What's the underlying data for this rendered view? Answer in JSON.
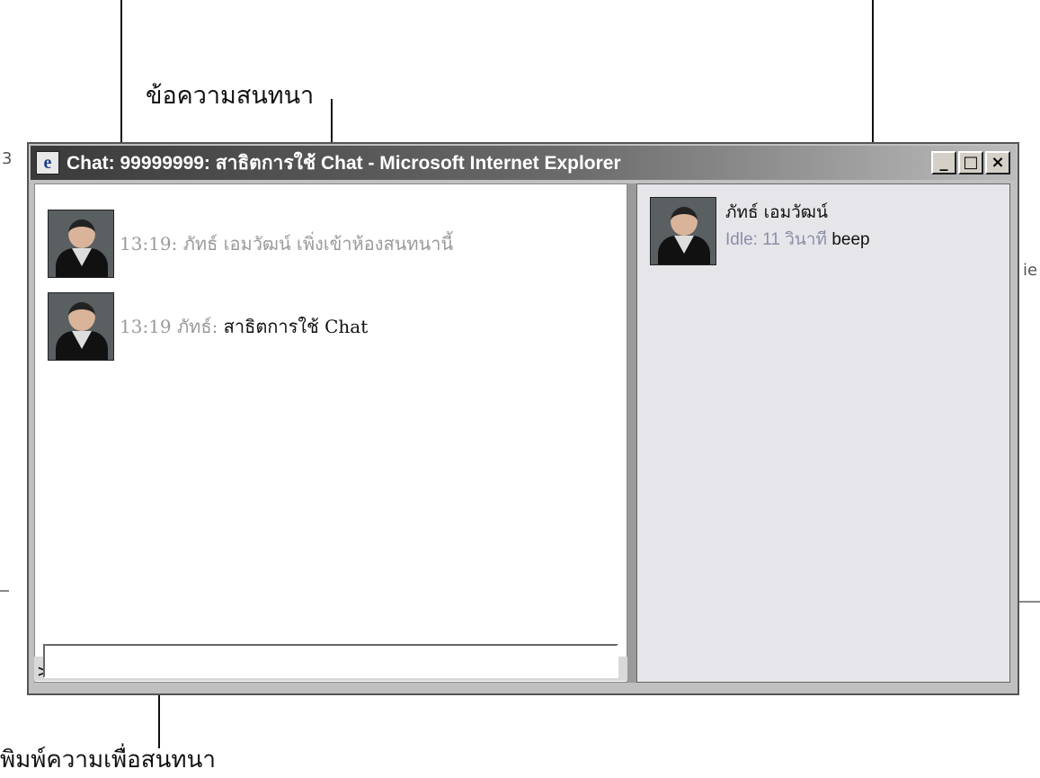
{
  "annotations": {
    "messages_label": "ข้อความสนทนา",
    "type_label": "พิมพ์ความเพื่อสนทนา"
  },
  "window": {
    "title": "Chat: 99999999: สาธิตการใช้ Chat - Microsoft Internet Explorer",
    "minimize_glyph": "_",
    "maximize_glyph": "□",
    "close_glyph": "×"
  },
  "chat": {
    "messages": [
      {
        "text": "13:19: ภัทธ์ เอมวัฒน์ เพิ่งเข้าห้องสนทนานี้"
      },
      {
        "time_user": "13:19 ภัทธ์:",
        "body": " สาธิตการใช้ Chat"
      }
    ],
    "prompt": ">>",
    "input_value": ""
  },
  "users": [
    {
      "name": "ภัทธ์ เอมวัฒน์",
      "status": "Idle: 11 วินาที",
      "action": "beep"
    }
  ],
  "edge_fragments": {
    "left": "3",
    "right": "ie"
  }
}
